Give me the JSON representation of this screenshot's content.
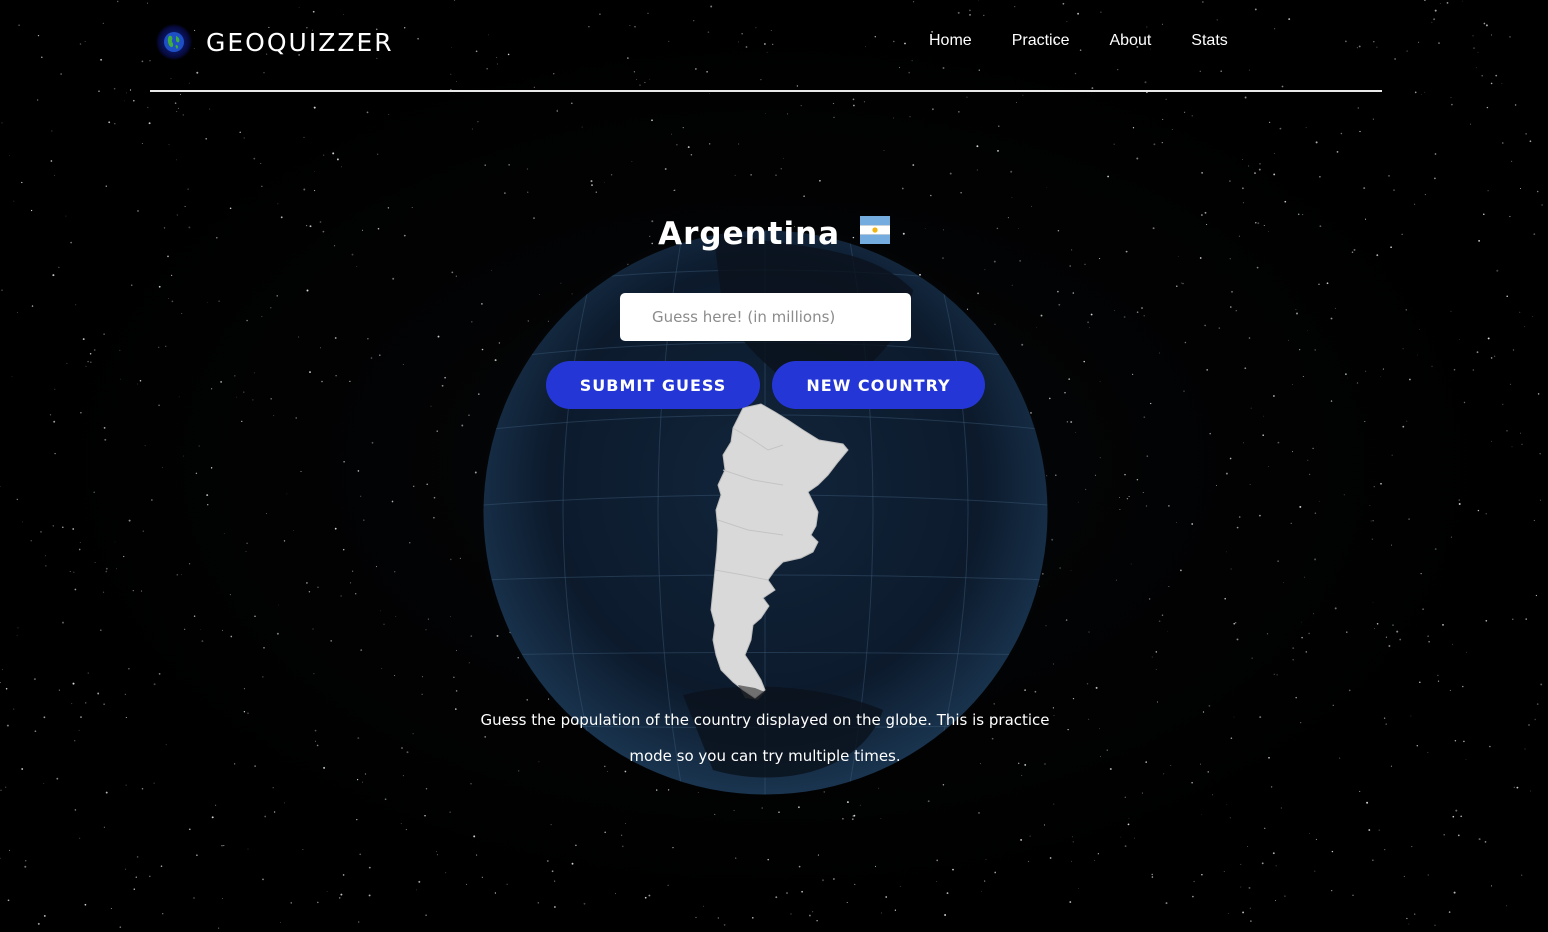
{
  "app": {
    "logo_text": "GEOQUIZZER",
    "logo_icon": "globe-icon"
  },
  "nav": {
    "items": [
      {
        "label": "Home"
      },
      {
        "label": "Practice"
      },
      {
        "label": "About"
      },
      {
        "label": "Stats"
      }
    ]
  },
  "quiz": {
    "country_name": "Argentina",
    "flag_icon": "argentina-flag-icon",
    "guess_placeholder": "Guess here! (in millions)",
    "guess_value": "",
    "submit_label": "SUBMIT GUESS",
    "new_country_label": "NEW COUNTRY",
    "instructions": "Guess the population of the country displayed on the globe. This is practice mode so you can try multiple times."
  },
  "colors": {
    "button_blue": "#2437d6",
    "background": "#000000",
    "globe_ocean": "#0c1a2c",
    "highlight_country": "#d9d9d9"
  }
}
